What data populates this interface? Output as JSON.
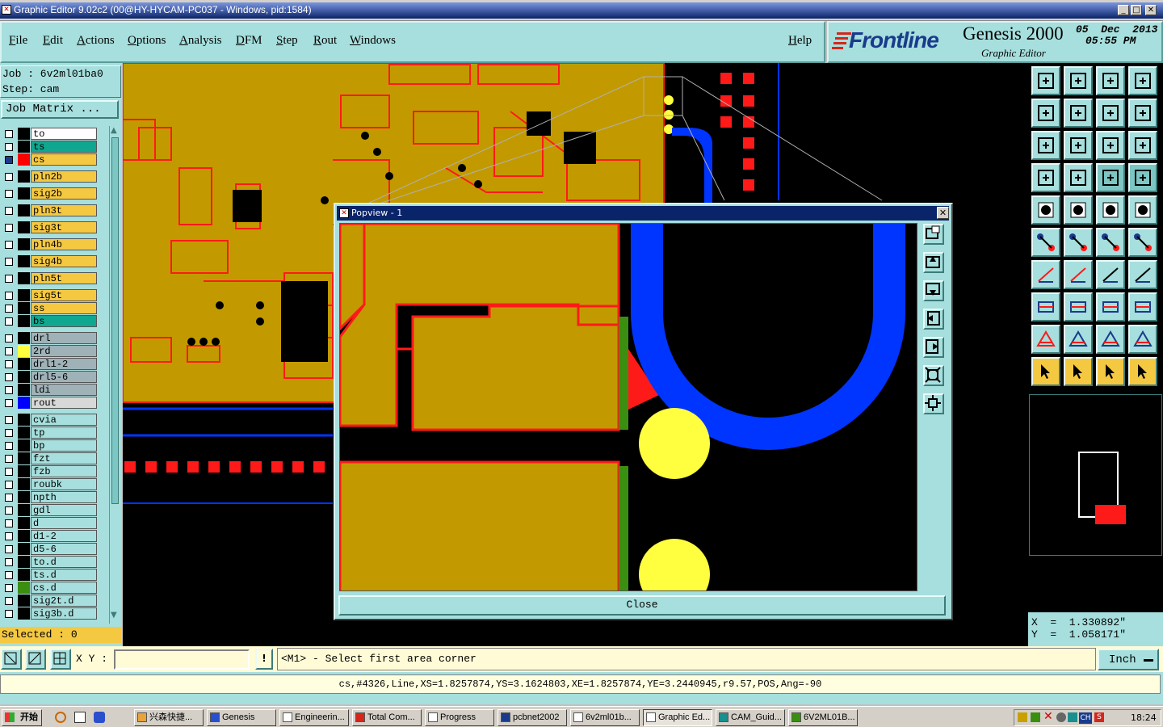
{
  "window": {
    "title": "Graphic Editor 9.02c2 (00@HY-HYCAM-PC037 - Windows, pid:1584)"
  },
  "menu": [
    "File",
    "Edit",
    "Actions",
    "Options",
    "Analysis",
    "DFM",
    "Step",
    "Rout",
    "Windows"
  ],
  "help": "Help",
  "brand": {
    "logo": "Frontline",
    "product": "Genesis 2000",
    "subtitle": "Graphic Editor",
    "date": "05  Dec  2013",
    "time": "05:55 PM"
  },
  "job": {
    "job_label": "Job :  6v2ml01ba0",
    "step_label": "Step:  cam",
    "matrix_button": "Job Matrix ..."
  },
  "layers": [
    {
      "name": "to",
      "color": "#ffffff",
      "sw": "#000000",
      "checked": false
    },
    {
      "name": "ts",
      "color": "#0fa78f",
      "sw": "#000000",
      "checked": false
    },
    {
      "name": "cs",
      "color": "#f5c842",
      "sw": "#ff0000",
      "checked": true
    },
    {
      "name": "pln2b",
      "color": "#f5c842",
      "sw": "#000000",
      "checked": false
    },
    {
      "name": "sig2b",
      "color": "#f5c842",
      "sw": "#000000",
      "checked": false
    },
    {
      "name": "pln3t",
      "color": "#f5c842",
      "sw": "#000000",
      "checked": false
    },
    {
      "name": "sig3t",
      "color": "#f5c842",
      "sw": "#000000",
      "checked": false
    },
    {
      "name": "pln4b",
      "color": "#f5c842",
      "sw": "#000000",
      "checked": false
    },
    {
      "name": "sig4b",
      "color": "#f5c842",
      "sw": "#000000",
      "checked": false
    },
    {
      "name": "pln5t",
      "color": "#f5c842",
      "sw": "#000000",
      "checked": false
    },
    {
      "name": "sig5t",
      "color": "#f5c842",
      "sw": "#000000",
      "checked": false
    },
    {
      "name": "ss",
      "color": "#f5c842",
      "sw": "#000000",
      "checked": false
    },
    {
      "name": "bs",
      "color": "#0fa78f",
      "sw": "#000000",
      "checked": false
    },
    {
      "name": "drl",
      "color": "#9fb2b8",
      "sw": "#000000",
      "checked": false
    },
    {
      "name": "2rd",
      "color": "#9fb2b8",
      "sw": "#ffff40",
      "checked": false
    },
    {
      "name": "drl1-2",
      "color": "#9fb2b8",
      "sw": "#000000",
      "checked": false
    },
    {
      "name": "drl5-6",
      "color": "#9fb2b8",
      "sw": "#000000",
      "checked": false
    },
    {
      "name": "ldi",
      "color": "#9fb2b8",
      "sw": "#000000",
      "checked": false
    },
    {
      "name": "rout",
      "color": "#d8d8d8",
      "sw": "#0000ff",
      "checked": false
    },
    {
      "name": "cvia",
      "color": "#a6dfdd",
      "sw": "#000000",
      "checked": false
    },
    {
      "name": "tp",
      "color": "#a6dfdd",
      "sw": "#000000",
      "checked": false
    },
    {
      "name": "bp",
      "color": "#a6dfdd",
      "sw": "#000000",
      "checked": false
    },
    {
      "name": "fzt",
      "color": "#a6dfdd",
      "sw": "#000000",
      "checked": false
    },
    {
      "name": "fzb",
      "color": "#a6dfdd",
      "sw": "#000000",
      "checked": false
    },
    {
      "name": "roubk",
      "color": "#a6dfdd",
      "sw": "#000000",
      "checked": false
    },
    {
      "name": "npth",
      "color": "#a6dfdd",
      "sw": "#000000",
      "checked": false
    },
    {
      "name": "gdl",
      "color": "#a6dfdd",
      "sw": "#000000",
      "checked": false
    },
    {
      "name": "d",
      "color": "#a6dfdd",
      "sw": "#000000",
      "checked": false
    },
    {
      "name": "d1-2",
      "color": "#a6dfdd",
      "sw": "#000000",
      "checked": false
    },
    {
      "name": "d5-6",
      "color": "#a6dfdd",
      "sw": "#000000",
      "checked": false
    },
    {
      "name": "to.d",
      "color": "#a6dfdd",
      "sw": "#000000",
      "checked": false
    },
    {
      "name": "ts.d",
      "color": "#a6dfdd",
      "sw": "#000000",
      "checked": false
    },
    {
      "name": "cs.d",
      "color": "#a6dfdd",
      "sw": "#3a8f10",
      "checked": false
    },
    {
      "name": "sig2t.d",
      "color": "#a6dfdd",
      "sw": "#000000",
      "checked": false
    },
    {
      "name": "sig3b.d",
      "color": "#a6dfdd",
      "sw": "#000000",
      "checked": false
    }
  ],
  "selected": "Selected : 0",
  "popview": {
    "title": "Popview - 1",
    "close": "Close"
  },
  "coords": {
    "x": "X  =  1.330892\"",
    "y": "Y  =  1.058171\""
  },
  "cmd": {
    "xy_label": "X Y :",
    "xy_value": "",
    "prompt": "<M1> - Select first area corner",
    "units": "Inch"
  },
  "status": "cs,#4326,Line,XS=1.8257874,YS=3.1624803,XE=1.8257874,YE=3.2440945,r9.57,POS,Ang=-90",
  "taskbar": {
    "start": "开始",
    "items": [
      "兴森快捷...",
      "Genesis",
      "Engineerin...",
      "Total Com...",
      "Progress",
      "pcbnet2002",
      "6v2ml01b...",
      "Graphic Ed...",
      "CAM_Guid...",
      "6V2ML01B..."
    ],
    "clock": "18:24",
    "tray_ch": "CH"
  },
  "colors": {
    "copper": "#c29a00",
    "trace_outline": "#ff1a1a",
    "rout_blue": "#0035ff",
    "drill_yellow": "#ffff40",
    "panel": "#a6dfdd"
  }
}
